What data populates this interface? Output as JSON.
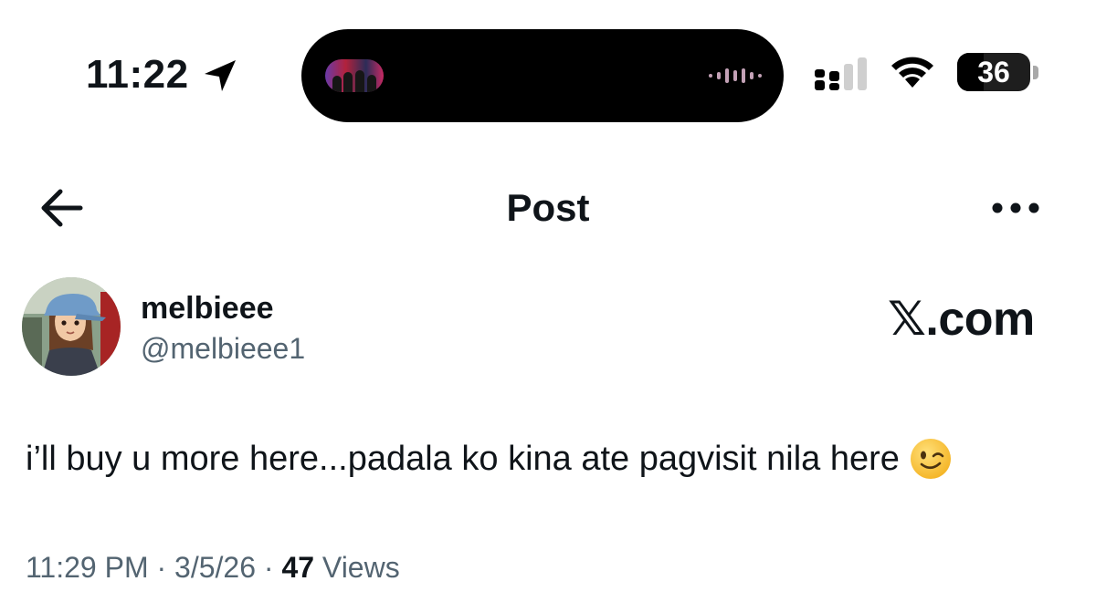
{
  "status_bar": {
    "time": "11:22",
    "battery_level": "36",
    "battery_fraction": 0.36,
    "icons": [
      "location-arrow-icon",
      "signal-icon",
      "wifi-icon",
      "battery-icon"
    ]
  },
  "header": {
    "title": "Post",
    "back_icon": "arrow-left-icon",
    "more_icon": "more-horizontal-icon"
  },
  "post": {
    "author": {
      "display_name": "melbieee",
      "handle": "@melbieee1"
    },
    "watermark": "𝕏.com",
    "text": "i’ll buy u more here...padala ko kina ate pagvisit nila here",
    "emoji": "winking-face-icon",
    "meta": {
      "time": "11:29 PM",
      "separator": " · ",
      "date": "3/5/26",
      "views_count": "47",
      "views_label": "Views"
    }
  }
}
